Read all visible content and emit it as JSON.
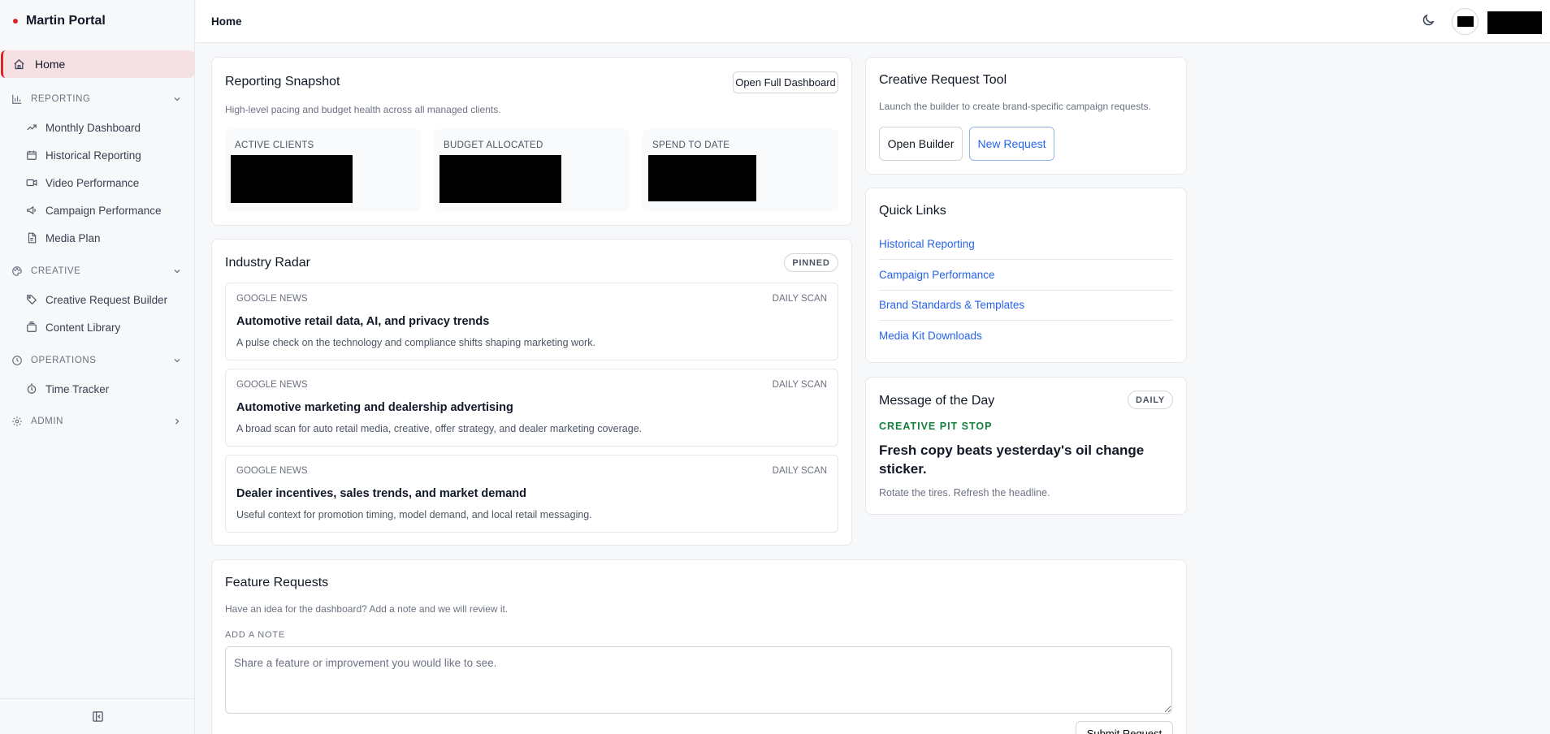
{
  "app": {
    "title": "Martin Portal"
  },
  "topbar": {
    "breadcrumb": "Home"
  },
  "sidebar": {
    "home": "Home",
    "sections": [
      {
        "label": "REPORTING",
        "items": [
          "Monthly Dashboard",
          "Historical Reporting",
          "Video Performance",
          "Campaign Performance",
          "Media Plan"
        ]
      },
      {
        "label": "CREATIVE",
        "items": [
          "Creative Request Builder",
          "Content Library"
        ]
      },
      {
        "label": "OPERATIONS",
        "items": [
          "Time Tracker"
        ]
      },
      {
        "label": "ADMIN",
        "items": []
      }
    ]
  },
  "snapshot": {
    "title": "Reporting Snapshot",
    "subtitle": "High-level pacing and budget health across all managed clients.",
    "open_button": "Open Full Dashboard",
    "stats": [
      {
        "label": "ACTIVE CLIENTS"
      },
      {
        "label": "BUDGET ALLOCATED"
      },
      {
        "label": "SPEND TO DATE"
      }
    ]
  },
  "radar": {
    "title": "Industry Radar",
    "badge": "PINNED",
    "items": [
      {
        "source": "GOOGLE NEWS",
        "frequency": "DAILY SCAN",
        "title": "Automotive retail data, AI, and privacy trends",
        "description": "A pulse check on the technology and compliance shifts shaping marketing work."
      },
      {
        "source": "GOOGLE NEWS",
        "frequency": "DAILY SCAN",
        "title": "Automotive marketing and dealership advertising",
        "description": "A broad scan for auto retail media, creative, offer strategy, and dealer marketing coverage."
      },
      {
        "source": "GOOGLE NEWS",
        "frequency": "DAILY SCAN",
        "title": "Dealer incentives, sales trends, and market demand",
        "description": "Useful context for promotion timing, model demand, and local retail messaging."
      }
    ]
  },
  "creative_tool": {
    "title": "Creative Request Tool",
    "subtitle": "Launch the builder to create brand-specific campaign requests.",
    "open_builder": "Open Builder",
    "new_request": "New Request"
  },
  "quick_links": {
    "title": "Quick Links",
    "links": [
      "Historical Reporting",
      "Campaign Performance",
      "Brand Standards & Templates",
      "Media Kit Downloads"
    ]
  },
  "motd": {
    "title": "Message of the Day",
    "badge": "DAILY",
    "kicker": "CREATIVE PIT STOP",
    "headline": "Fresh copy beats yesterday's oil change sticker.",
    "body": "Rotate the tires. Refresh the headline."
  },
  "feature_requests": {
    "title": "Feature Requests",
    "subtitle": "Have an idea for the dashboard? Add a note and we will review it.",
    "note_label": "ADD A NOTE",
    "placeholder": "Share a feature or improvement you would like to see.",
    "submit": "Submit Request"
  },
  "colors": {
    "accent": "#dc2626",
    "link": "#2563eb",
    "kicker": "#15803d"
  }
}
